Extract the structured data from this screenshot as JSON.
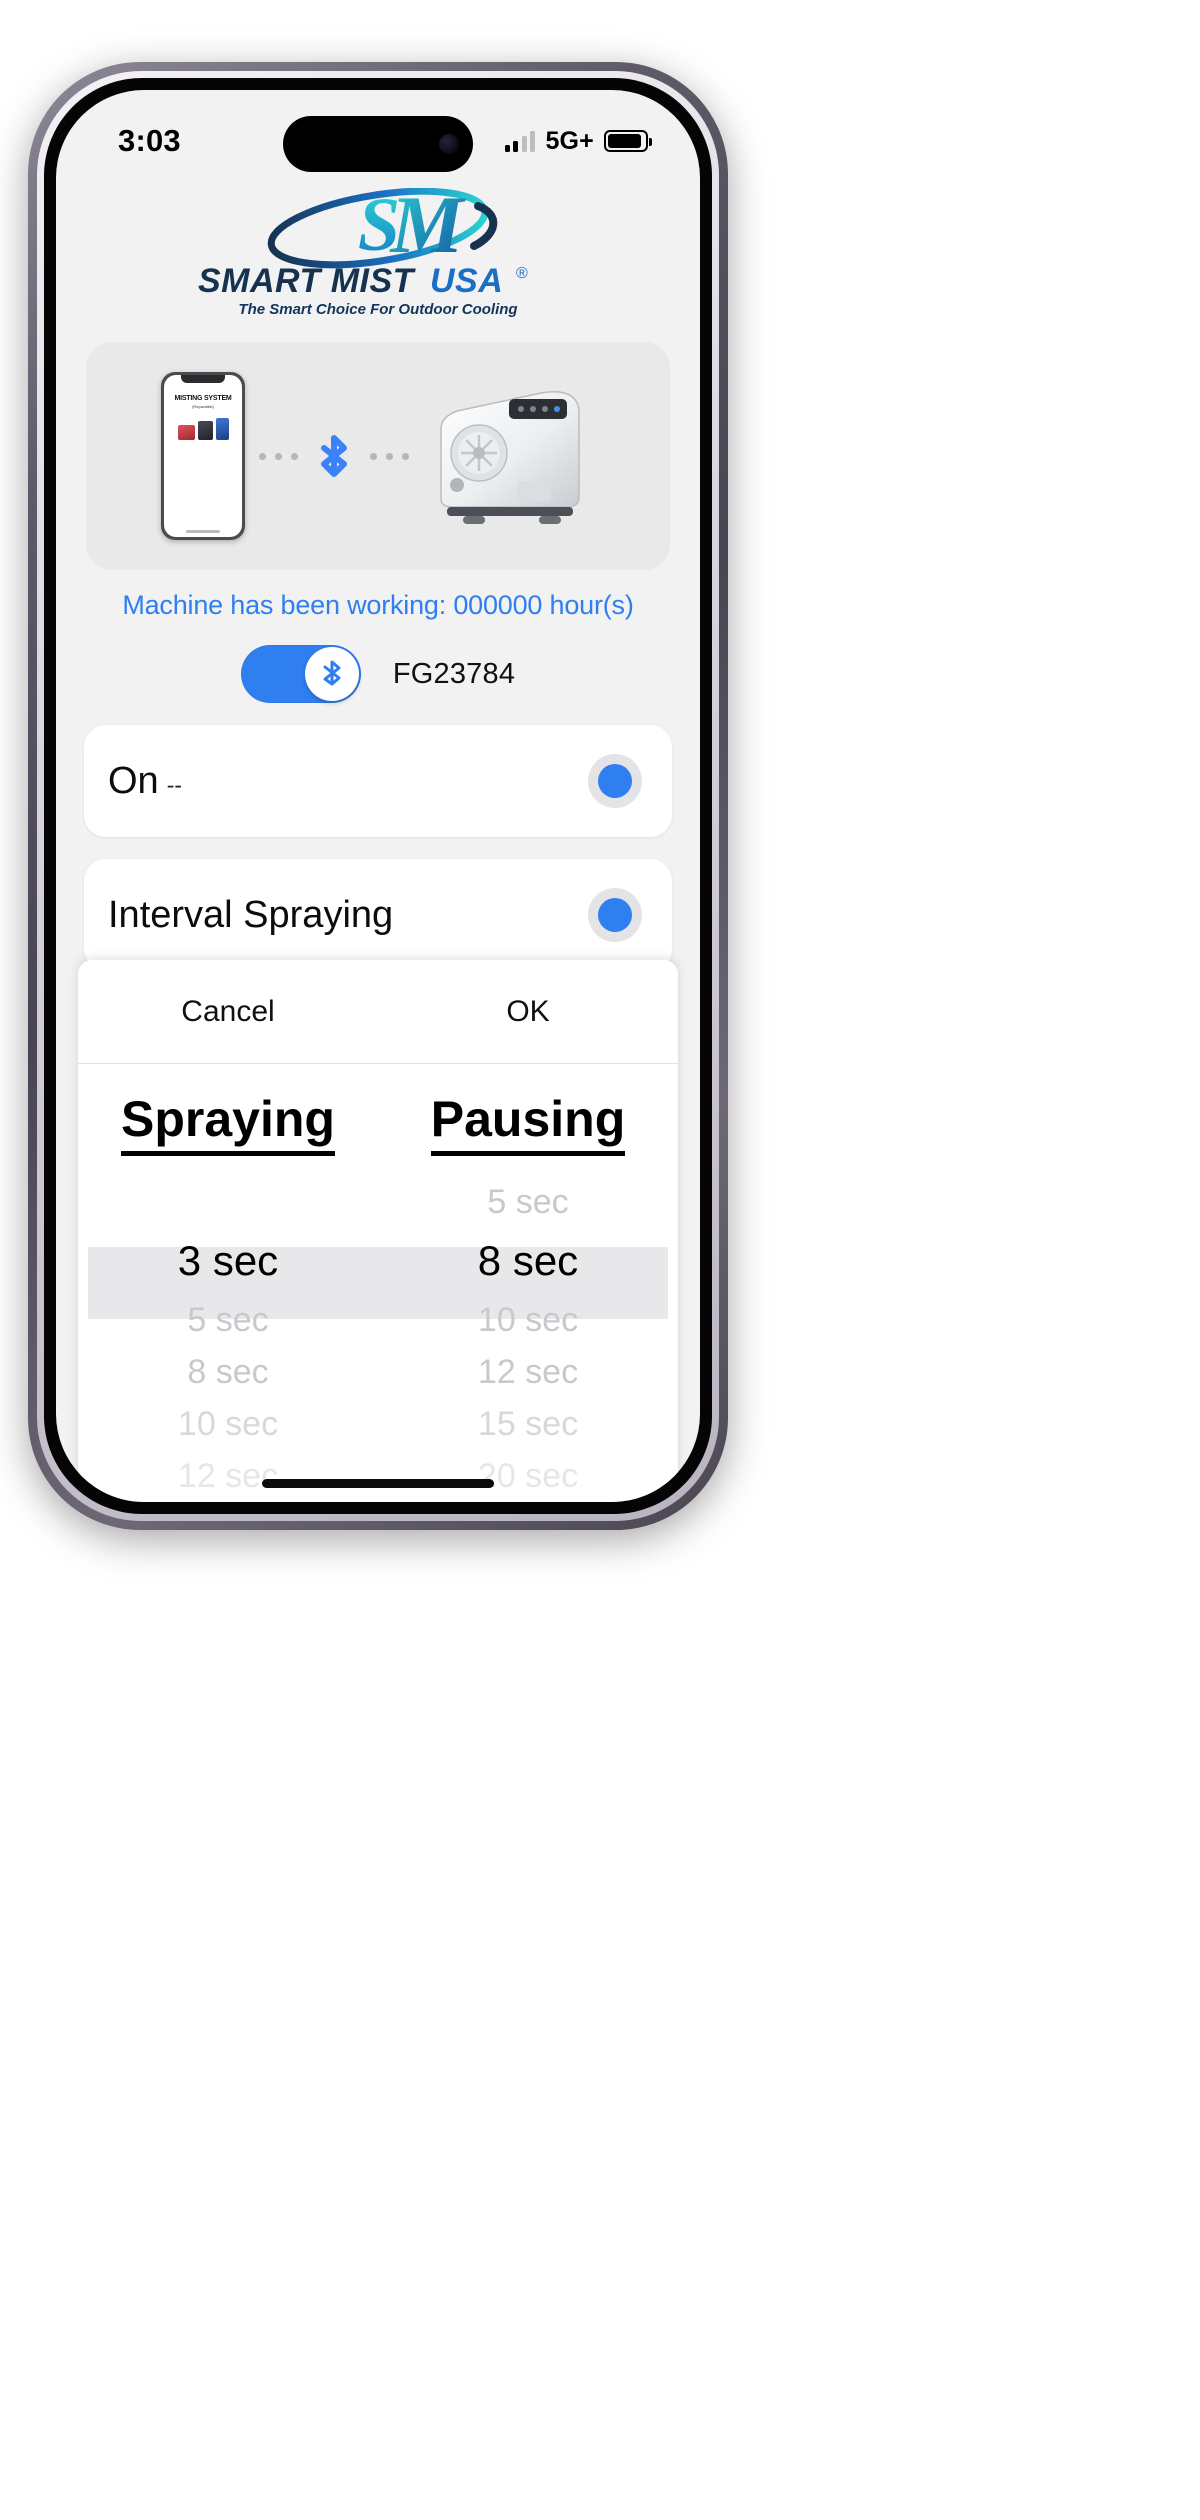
{
  "status_bar": {
    "time": "3:03",
    "network": "5G+",
    "signal_icon": "cellular-signal-icon",
    "battery_icon": "battery-icon",
    "battery_level": 92
  },
  "brand": {
    "mark": "SM",
    "name_primary": "SMART MIST",
    "name_secondary": "USA",
    "registered_mark": "®",
    "tagline": "The Smart Choice For Outdoor Cooling",
    "colors": {
      "teal": "#25c3c7",
      "blue": "#1a6fc4",
      "navy": "#12355b"
    }
  },
  "illustration": {
    "phone_screen_title": "MISTING SYSTEM",
    "phone_screen_subtitle": "(Reparatlist)",
    "bluetooth_icon": "bluetooth-icon",
    "machine_label": "misting-machine-illustration",
    "connection_dots": 6
  },
  "status_text": "Machine has been working: 000000 hour(s)",
  "status_text_color": "#2f7ff0",
  "bluetooth": {
    "toggle_state": "on",
    "toggle_icon": "bluetooth-icon",
    "device_name": "FG23784",
    "accent_color": "#2f7ff0"
  },
  "options": [
    {
      "label": "On",
      "suffix": "--",
      "selected": true,
      "name": "power-state-row"
    },
    {
      "label": "Interval Spraying",
      "suffix": "",
      "selected": true,
      "name": "spray-mode-row"
    }
  ],
  "picker": {
    "cancel_label": "Cancel",
    "ok_label": "OK",
    "columns": [
      {
        "title": "Spraying",
        "selected": "3 sec",
        "above": [],
        "below": [
          "5 sec",
          "8 sec",
          "10 sec",
          "12 sec"
        ]
      },
      {
        "title": "Pausing",
        "selected": "8 sec",
        "above": [
          "5 sec"
        ],
        "below": [
          "10 sec",
          "12 sec",
          "15 sec",
          "20 sec"
        ]
      }
    ]
  }
}
